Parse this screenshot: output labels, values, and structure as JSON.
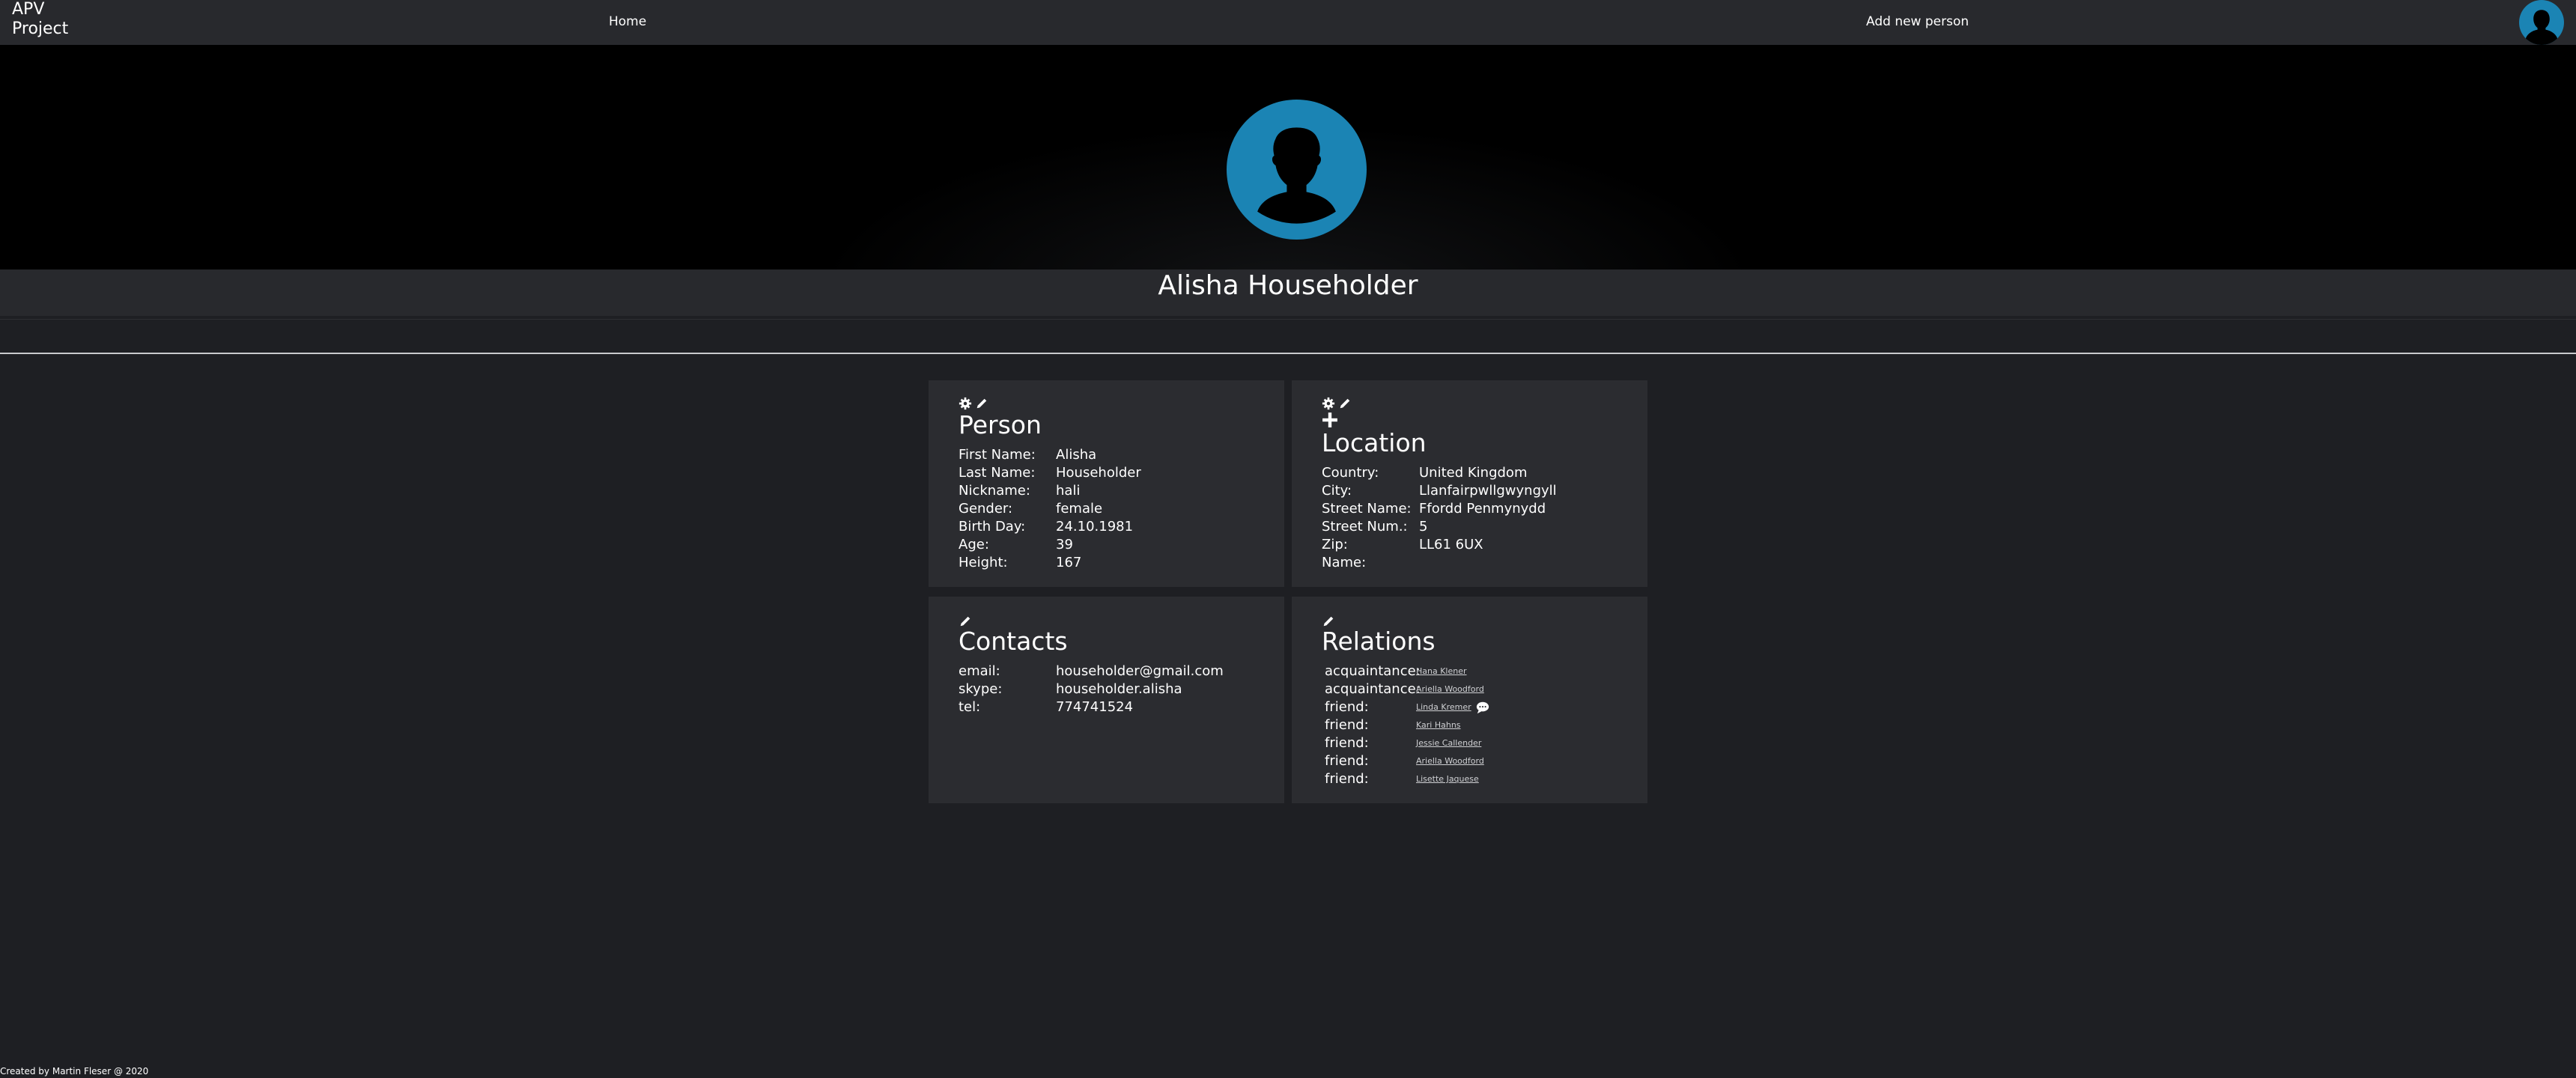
{
  "navbar": {
    "brand_line1": "APV",
    "brand_line2": "Project",
    "home_label": "Home",
    "add_person_label": "Add new person"
  },
  "profile": {
    "full_name": "Alisha Householder"
  },
  "person_card": {
    "title": "Person",
    "rows": [
      {
        "label": "First Name:",
        "value": "Alisha"
      },
      {
        "label": "Last Name:",
        "value": "Householder"
      },
      {
        "label": "Nickname:",
        "value": "hali"
      },
      {
        "label": "Gender:",
        "value": "female"
      },
      {
        "label": "Birth Day:",
        "value": "24.10.1981"
      },
      {
        "label": "Age:",
        "value": "39"
      },
      {
        "label": "Height:",
        "value": "167"
      }
    ]
  },
  "location_card": {
    "title": "Location",
    "rows": [
      {
        "label": "Country:",
        "value": "United Kingdom"
      },
      {
        "label": "City:",
        "value": "Llanfairpwllgwyngyll"
      },
      {
        "label": "Street Name:",
        "value": "Ffordd Penmynydd"
      },
      {
        "label": "Street Num.:",
        "value": "5"
      },
      {
        "label": "Zip:",
        "value": "LL61 6UX"
      },
      {
        "label": "Name:",
        "value": ""
      }
    ]
  },
  "contacts_card": {
    "title": "Contacts",
    "rows": [
      {
        "label": "email:",
        "value": "householder@gmail.com"
      },
      {
        "label": "skype:",
        "value": "householder.alisha"
      },
      {
        "label": "tel:",
        "value": "774741524"
      }
    ]
  },
  "relations_card": {
    "title": "Relations",
    "rows": [
      {
        "label": "acquaintance:",
        "value": "Hana Klener"
      },
      {
        "label": "acquaintance:",
        "value": "Ariella Woodford"
      },
      {
        "label": "friend:",
        "value": "Linda Kremer"
      },
      {
        "label": "friend:",
        "value": "Kari Hahns"
      },
      {
        "label": "friend:",
        "value": "Jessie Callender"
      },
      {
        "label": "friend:",
        "value": "Ariella Woodford"
      },
      {
        "label": "friend:",
        "value": "Lisette Jaquese"
      }
    ]
  },
  "footer": {
    "text": "Created by Martin Fleser @ 2020"
  },
  "colors": {
    "accent": "#1b84b4",
    "background": "#1e1f23",
    "card": "#2b2c30"
  },
  "icons": [
    "user-silhouette-icon",
    "gear-icon",
    "pencil-icon",
    "plus-icon",
    "chat-icon"
  ]
}
